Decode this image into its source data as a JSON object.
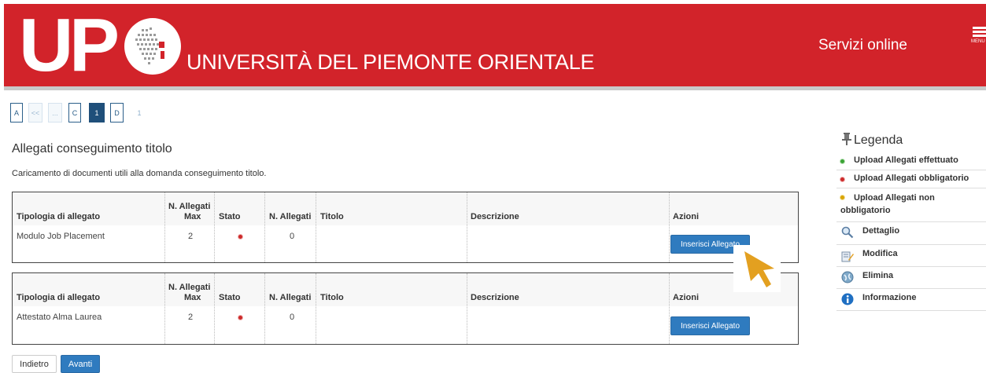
{
  "header": {
    "logo_letters": "UPO",
    "university_name": "UNIVERSITÀ DEL PIEMONTE ORIENTALE",
    "services_link": "Servizi online",
    "menu_label": "MENU",
    "brand_color": "#d2232a"
  },
  "pager": {
    "items": [
      "A",
      "<<",
      "...",
      "C",
      "1",
      "D",
      "1"
    ],
    "active_index": 4
  },
  "page": {
    "title": "Allegati conseguimento titolo",
    "description": "Caricamento di documenti utili alla domanda conseguimento titolo."
  },
  "table_headers": {
    "type": "Tipologia di allegato",
    "max_line1": "N. Allegati",
    "max_line2": "Max",
    "status": "Stato",
    "count": "N. Allegati",
    "title": "Titolo",
    "description": "Descrizione",
    "actions": "Azioni"
  },
  "tables": [
    {
      "type": "Modulo Job Placement",
      "max": "2",
      "status_icon": "red-dot-icon",
      "count": "0",
      "title": "",
      "description": "",
      "action_label": "Inserisci Allegato"
    },
    {
      "type": "Attestato Alma Laurea",
      "max": "2",
      "status_icon": "red-dot-icon",
      "count": "0",
      "title": "",
      "description": "",
      "action_label": "Inserisci Allegato"
    }
  ],
  "legend": {
    "title": "Legenda",
    "items": [
      {
        "label": "Upload Allegati effettuato",
        "icon": "green-dot-icon"
      },
      {
        "label": "Upload Allegati obbligatorio",
        "icon": "red-dot-icon"
      },
      {
        "label": "Upload Allegati non obbligatorio",
        "icon": "yellow-dot-icon"
      },
      {
        "label": "Dettaglio",
        "icon": "magnifier-icon"
      },
      {
        "label": "Modifica",
        "icon": "edit-icon"
      },
      {
        "label": "Elimina",
        "icon": "delete-icon"
      },
      {
        "label": "Informazione",
        "icon": "info-icon"
      }
    ]
  },
  "footer": {
    "back_label": "Indietro",
    "next_label": "Avanti"
  },
  "colors": {
    "status_red": "#cc2a2a",
    "status_green": "#3aa335",
    "status_yellow": "#d9a400",
    "button_blue": "#2f7bbf",
    "cursor_orange": "#e3a020"
  }
}
